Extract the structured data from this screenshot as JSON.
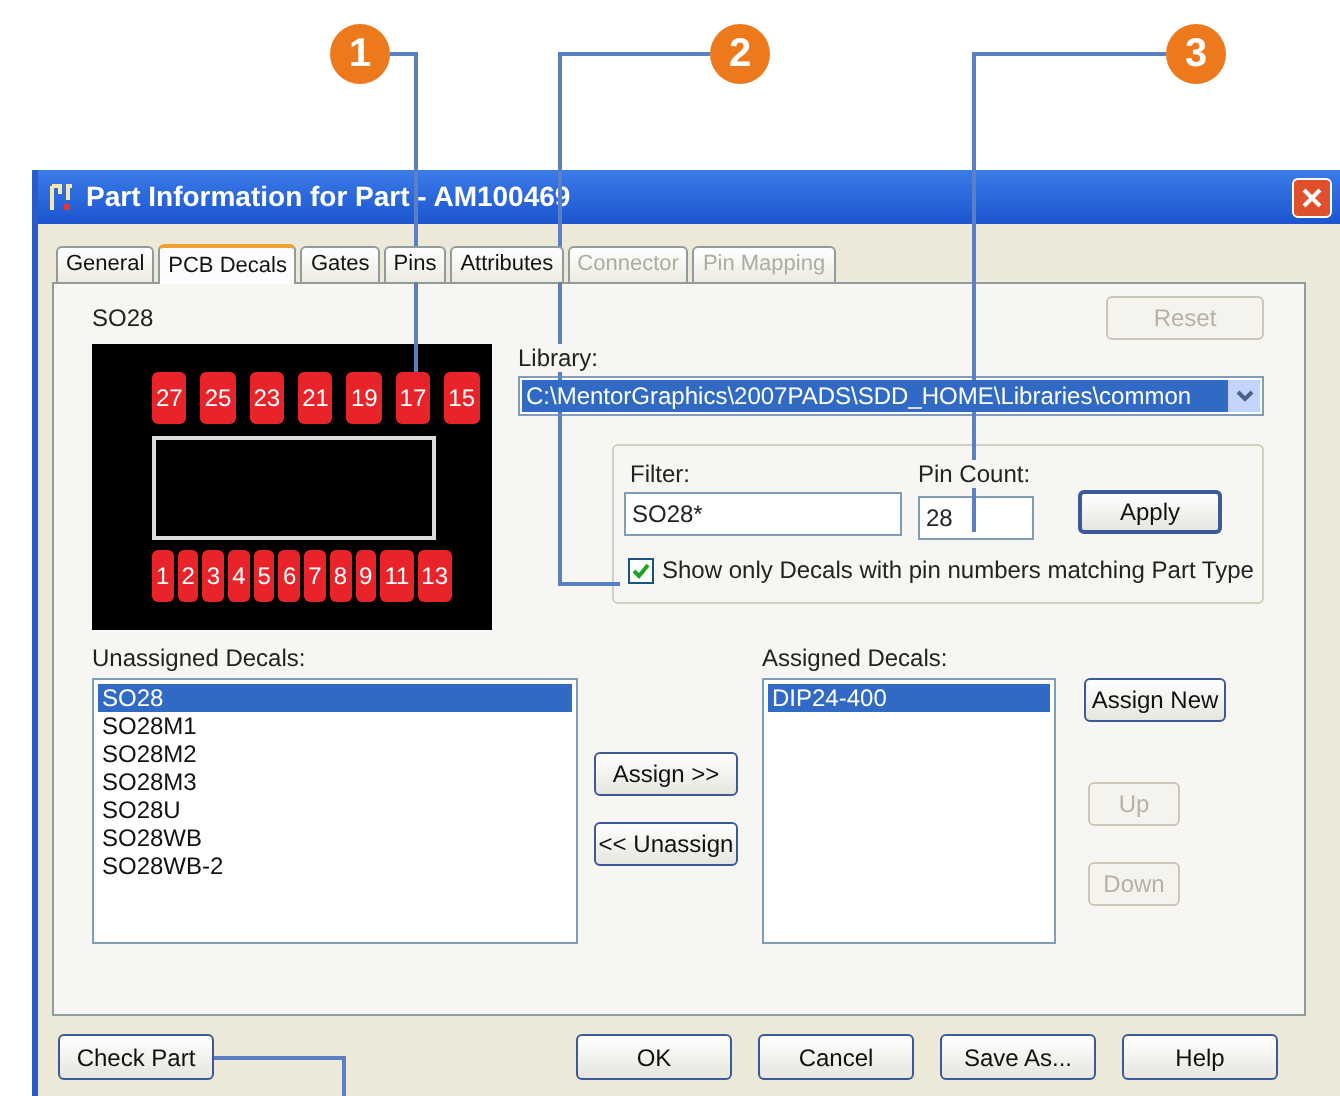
{
  "callouts": [
    {
      "label": "1"
    },
    {
      "label": "2"
    },
    {
      "label": "3"
    }
  ],
  "window": {
    "title": "Part Information for Part - AM100469"
  },
  "tabs": [
    {
      "label": "General",
      "selected": false,
      "disabled": false
    },
    {
      "label": "PCB Decals",
      "selected": true,
      "disabled": false
    },
    {
      "label": "Gates",
      "selected": false,
      "disabled": false
    },
    {
      "label": "Pins",
      "selected": false,
      "disabled": false
    },
    {
      "label": "Attributes",
      "selected": false,
      "disabled": false
    },
    {
      "label": "Connector",
      "selected": false,
      "disabled": true
    },
    {
      "label": "Pin Mapping",
      "selected": false,
      "disabled": true
    }
  ],
  "decal_preview": {
    "name": "SO28",
    "top_pins": [
      "27",
      "25",
      "23",
      "21",
      "19",
      "17",
      "15"
    ],
    "bottom_pins": [
      "1",
      "2",
      "3",
      "4",
      "5",
      "6",
      "7",
      "8",
      "9",
      "11",
      "13"
    ]
  },
  "reset_button": {
    "label": "Reset",
    "disabled": true
  },
  "library": {
    "label": "Library:",
    "value": "C:\\MentorGraphics\\2007PADS\\SDD_HOME\\Libraries\\common"
  },
  "filter": {
    "label": "Filter:",
    "value": "SO28*"
  },
  "pin_count": {
    "label": "Pin Count:",
    "value": "28"
  },
  "apply_button": {
    "label": "Apply"
  },
  "match_checkbox": {
    "label": "Show only Decals with pin numbers matching Part Type",
    "checked": true
  },
  "unassigned": {
    "label": "Unassigned Decals:",
    "items": [
      {
        "label": "SO28",
        "selected": true
      },
      {
        "label": "SO28M1",
        "selected": false
      },
      {
        "label": "SO28M2",
        "selected": false
      },
      {
        "label": "SO28M3",
        "selected": false
      },
      {
        "label": "SO28U",
        "selected": false
      },
      {
        "label": "SO28WB",
        "selected": false
      },
      {
        "label": "SO28WB-2",
        "selected": false
      }
    ]
  },
  "move_buttons": [
    {
      "label": "Assign >>"
    },
    {
      "label": "<< Unassign"
    }
  ],
  "assigned": {
    "label": "Assigned Decals:",
    "items": [
      {
        "label": "DIP24-400",
        "selected": true
      }
    ]
  },
  "side_buttons": [
    {
      "label": "Assign New",
      "disabled": false
    },
    {
      "label": "Up",
      "disabled": true
    },
    {
      "label": "Down",
      "disabled": true
    }
  ],
  "bottom_left_button": {
    "label": "Check Part"
  },
  "bottom_buttons": [
    {
      "label": "OK"
    },
    {
      "label": "Cancel"
    },
    {
      "label": "Save As..."
    },
    {
      "label": "Help"
    }
  ]
}
